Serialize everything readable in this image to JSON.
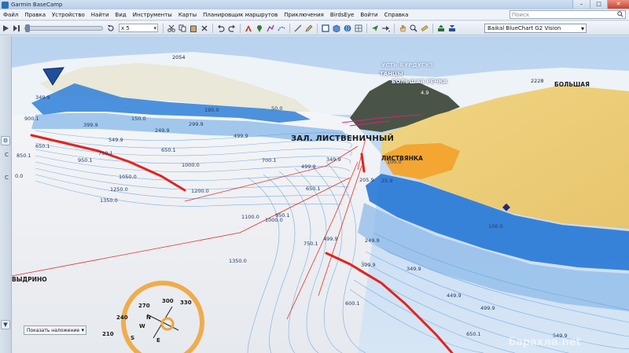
{
  "window": {
    "title": "Garmin BaseCamp",
    "minimize": "–",
    "maximize": "□",
    "close": "✕"
  },
  "menu": {
    "items": [
      "Файл",
      "Правка",
      "Устройство",
      "Найти",
      "Вид",
      "Инструменты",
      "Карты",
      "Планировщик маршрутов",
      "Приключения",
      "BirdsEye",
      "Войти",
      "Справка"
    ],
    "search_placeholder": "Поиск"
  },
  "toolbar": {
    "speed_value": "x 5",
    "map_product": "Baikal BlueChart G2 Vision",
    "icons": [
      "play-icon",
      "step-icon",
      "loop-icon",
      "cut-icon",
      "copy-icon",
      "paste-icon",
      "delete-icon",
      "undo-icon",
      "redo-icon",
      "text-icon",
      "waypoint-icon",
      "route-icon",
      "track-icon",
      "measure-icon",
      "pencil-icon",
      "map-2d-icon",
      "map-3d-icon",
      "globe-icon",
      "grid-icon",
      "nav-icon",
      "route-nav-icon",
      "hand-icon",
      "zoom-icon",
      "ruler-icon",
      "send-icon",
      "receive-icon"
    ]
  },
  "left_panel": {
    "letters": [
      "C",
      "C"
    ]
  },
  "map": {
    "place_labels": {
      "main_bay": "ЗАЛ. ЛИСТВЕНИЧНЫЙ",
      "listvyanka": "ЛИСТВЯНКА",
      "bolshaya_rechka": "БОЛЬШАЯ РЕЧКА",
      "bolshaya": "БОЛЬШАЯ",
      "vydrino": "ВЫДРИНО",
      "burduguz": "УСТЬ-БУРДУГУЗ",
      "tantsy": "ТАНЦЫ"
    },
    "elevation_labels": [
      "2054",
      "2228",
      "4.9"
    ],
    "depth_labels": [
      "349.9",
      "900.1",
      "850.1",
      "650.1",
      "750.1",
      "950.1",
      "1050.0",
      "1250.0",
      "1350.0",
      "0.0",
      "399.9",
      "150.0",
      "249.9",
      "299.9",
      "190.0",
      "50.0",
      "549.9",
      "499.9",
      "650.1",
      "1000.0",
      "1200.0",
      "700.1",
      "349.9",
      "499.9",
      "650.1",
      "1100.0",
      "950.1",
      "1000.0",
      "1350.0",
      "100.0",
      "205.9",
      "25.9",
      "100.0",
      "249.9",
      "499.9",
      "750.1",
      "399.9",
      "349.9",
      "449.9",
      "499.9",
      "600.1",
      "650.1",
      "549.9"
    ],
    "overlay_button": "Показать наложение",
    "compass": {
      "degrees": [
        "270",
        "300",
        "330",
        "240",
        "210"
      ],
      "directions": [
        "W",
        "N",
        "S",
        "E"
      ]
    },
    "watermark": "барахла.net"
  }
}
